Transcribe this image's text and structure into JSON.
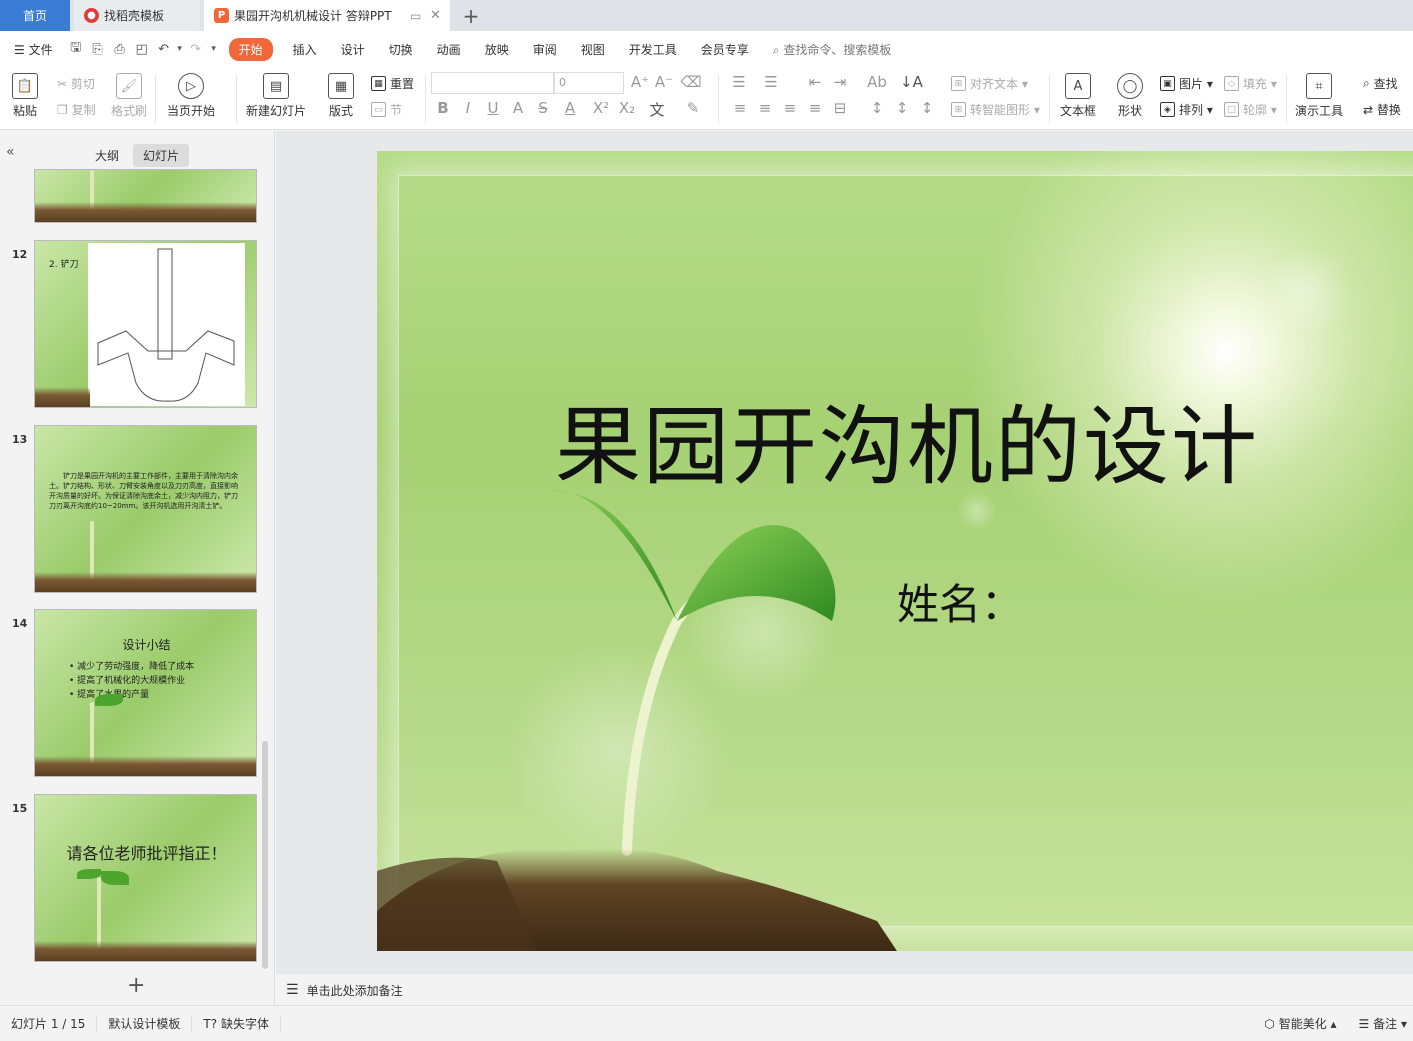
{
  "tabs": {
    "home": "首页",
    "template": "找稻壳模板",
    "document": "果园开沟机机械设计 答辩PPT"
  },
  "menu": {
    "file": "文件",
    "items": [
      "开始",
      "插入",
      "设计",
      "切换",
      "动画",
      "放映",
      "审阅",
      "视图",
      "开发工具",
      "会员专享"
    ],
    "search_placeholder": "查找命令、搜索模板"
  },
  "ribbon": {
    "paste": "粘贴",
    "cut": "剪切",
    "copy": "复制",
    "format_painter": "格式刷",
    "from_current": "当页开始",
    "new_slide": "新建幻灯片",
    "layout": "版式",
    "reset": "重置",
    "section": "节",
    "font_size": "0",
    "align_text": "对齐文本",
    "smartart": "转智能图形",
    "textbox": "文本框",
    "shape": "形状",
    "picture": "图片",
    "arrange": "排列",
    "fill": "填充",
    "outline": "轮廓",
    "present_tools": "演示工具",
    "find": "查找",
    "replace": "替换"
  },
  "left_panel": {
    "tab_outline": "大纲",
    "tab_slides": "幻灯片",
    "thumbs": [
      {
        "num": "12",
        "title": "2. 铲刀"
      },
      {
        "num": "13",
        "text": "铲刀是果园开沟机的主要工作部件，主要用于清除沟内余土。铲刀结构、形状、刀臂安装角度以及刀刃高度，直接影响开沟质量的好坏。为保证清除沟底余土，减少沟内阻力，铲刀刀刃离开沟底约10~20mm。该开沟机选用开沟清土铲。"
      },
      {
        "num": "14",
        "title": "设计小结",
        "bullets": [
          "减少了劳动强度，降低了成本",
          "提高了机械化的大规模作业",
          "提高了水果的产量"
        ]
      },
      {
        "num": "15",
        "title": "请各位老师批评指正！"
      }
    ]
  },
  "slide": {
    "title": "果园开沟机的设计",
    "subtitle": "姓名："
  },
  "notes_placeholder": "单击此处添加备注",
  "status": {
    "slide_counter": "幻灯片 1 / 15",
    "template": "默认设计模板",
    "missing_font": "缺失字体",
    "beautify": "智能美化",
    "notes": "备注"
  },
  "colors": {
    "accent": "#f0683a",
    "home_tab": "#3a7bd5",
    "slide_green": "#a6d173"
  }
}
